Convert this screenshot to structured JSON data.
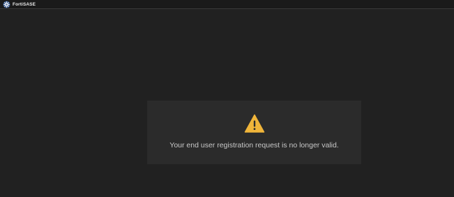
{
  "app": {
    "title": "FortiSASE",
    "logo_icon": "fortinet-gear-logo-icon"
  },
  "error": {
    "icon": "warning-triangle-icon",
    "icon_color": "#f0b53a",
    "message": "Your end user registration request is no longer valid."
  },
  "colors": {
    "background": "#212121",
    "topbar": "#1a1a1a",
    "panel": "#2b2b2b",
    "text": "#c8c8c8"
  }
}
